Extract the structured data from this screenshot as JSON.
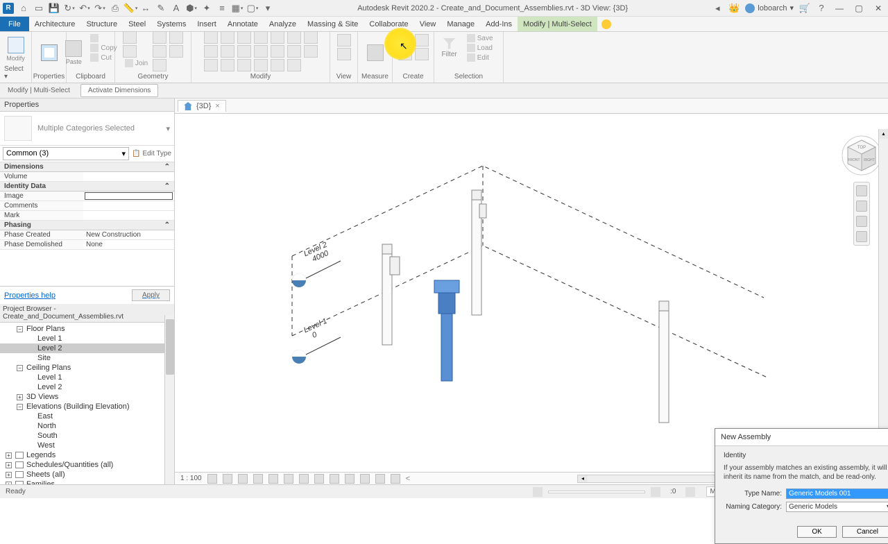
{
  "title": "Autodesk Revit 2020.2 - Create_and_Document_Assemblies.rvt - 3D View: {3D}",
  "user": "loboarch",
  "menu": {
    "file": "File",
    "items": [
      "Architecture",
      "Structure",
      "Steel",
      "Systems",
      "Insert",
      "Annotate",
      "Analyze",
      "Massing & Site",
      "Collaborate",
      "View",
      "Manage",
      "Add-Ins"
    ],
    "context": "Modify | Multi-Select"
  },
  "ribbon": {
    "select": "Select ▾",
    "modify": "Modify",
    "properties": "Properties",
    "clipboard": "Clipboard",
    "paste": "Paste",
    "copy": "Copy",
    "cut": "Cut",
    "join": "Join",
    "geometry": "Geometry",
    "modify_panel": "Modify",
    "view": "View",
    "measure": "Measure",
    "create": "Create",
    "selection": "Selection",
    "filter": "Filter",
    "save": "Save",
    "load": "Load",
    "edit": "Edit"
  },
  "sub_ribbon": {
    "context": "Modify | Multi-Select",
    "activate": "Activate Dimensions"
  },
  "doc_tab": {
    "name": "{3D}",
    "close": "×"
  },
  "properties": {
    "header": "Properties",
    "type_name": "Multiple Categories Selected",
    "instance": "Common (3)",
    "edit_type": "Edit Type",
    "sections": {
      "dimensions": "Dimensions",
      "identity": "Identity Data",
      "phasing": "Phasing"
    },
    "rows": {
      "volume": "Volume",
      "volume_v": "",
      "image": "Image",
      "image_v": "",
      "comments": "Comments",
      "comments_v": "",
      "mark": "Mark",
      "mark_v": "",
      "phase_created": "Phase Created",
      "phase_created_v": "New Construction",
      "phase_demolished": "Phase Demolished",
      "phase_demolished_v": "None"
    },
    "help": "Properties help",
    "apply": "Apply"
  },
  "browser": {
    "header": "Project Browser - Create_and_Document_Assemblies.rvt",
    "floor_plans": "Floor Plans",
    "fp_l1": "Level 1",
    "fp_l2": "Level 2",
    "fp_site": "Site",
    "ceiling_plans": "Ceiling Plans",
    "cp_l1": "Level 1",
    "cp_l2": "Level 2",
    "views_3d": "3D Views",
    "elevations": "Elevations (Building Elevation)",
    "el_east": "East",
    "el_north": "North",
    "el_south": "South",
    "el_west": "West",
    "legends": "Legends",
    "schedules": "Schedules/Quantities (all)",
    "sheets": "Sheets (all)",
    "families": "Families"
  },
  "canvas_labels": {
    "level1": "Level 1",
    "level1_v": "0",
    "level2": "Level 2",
    "level2_v": "4000"
  },
  "viewcube": {
    "top": "TOP",
    "front": "FRONT",
    "right": "RIGHT"
  },
  "dialog": {
    "title": "New Assembly",
    "section": "Identity",
    "desc": "If your assembly matches an existing assembly, it will inherit its name from the match, and be read-only.",
    "type_name_label": "Type Name:",
    "type_name_value": "Generic Models 001",
    "naming_cat_label": "Naming Category:",
    "naming_cat_value": "Generic Models",
    "ok": "OK",
    "cancel": "Cancel"
  },
  "view_ctrl": {
    "scale": "1 : 100"
  },
  "status": {
    "ready": "Ready",
    "zero": ":0",
    "workset": "Main Model"
  }
}
